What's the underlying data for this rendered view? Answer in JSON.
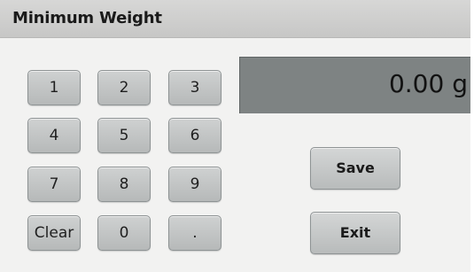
{
  "title": "Minimum Weight",
  "display": {
    "value": "0.00 g"
  },
  "keypad": {
    "keys": [
      "1",
      "2",
      "3",
      "4",
      "5",
      "6",
      "7",
      "8",
      "9",
      "Clear",
      "0",
      "."
    ]
  },
  "actions": {
    "save_label": "Save",
    "exit_label": "Exit"
  },
  "colors": {
    "background": "#f2f2f1",
    "title_bar": "#cfcfce",
    "display_bg": "#7e8383",
    "button": "#c3c5c5"
  }
}
